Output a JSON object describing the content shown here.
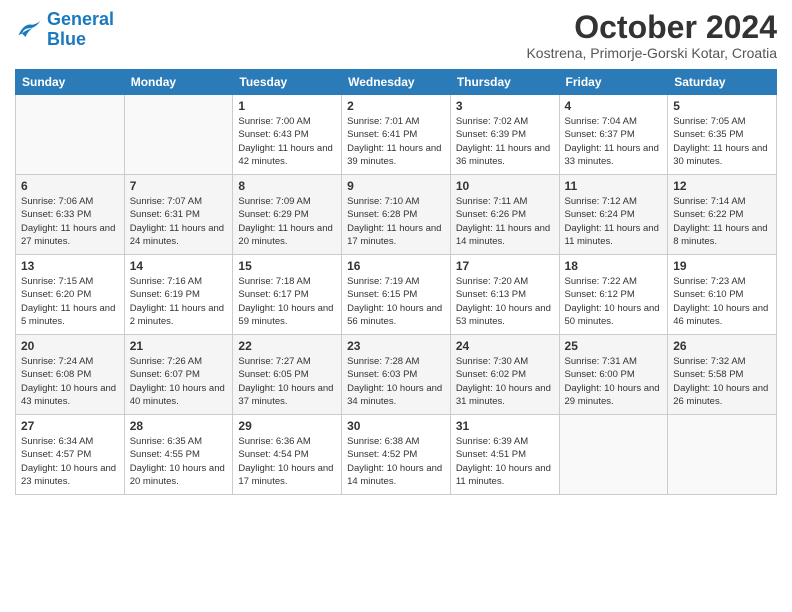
{
  "header": {
    "logo_line1": "General",
    "logo_line2": "Blue",
    "month_title": "October 2024",
    "location": "Kostrena, Primorje-Gorski Kotar, Croatia"
  },
  "weekdays": [
    "Sunday",
    "Monday",
    "Tuesday",
    "Wednesday",
    "Thursday",
    "Friday",
    "Saturday"
  ],
  "weeks": [
    [
      {
        "day": "",
        "sunrise": "",
        "sunset": "",
        "daylight": ""
      },
      {
        "day": "",
        "sunrise": "",
        "sunset": "",
        "daylight": ""
      },
      {
        "day": "1",
        "sunrise": "Sunrise: 7:00 AM",
        "sunset": "Sunset: 6:43 PM",
        "daylight": "Daylight: 11 hours and 42 minutes."
      },
      {
        "day": "2",
        "sunrise": "Sunrise: 7:01 AM",
        "sunset": "Sunset: 6:41 PM",
        "daylight": "Daylight: 11 hours and 39 minutes."
      },
      {
        "day": "3",
        "sunrise": "Sunrise: 7:02 AM",
        "sunset": "Sunset: 6:39 PM",
        "daylight": "Daylight: 11 hours and 36 minutes."
      },
      {
        "day": "4",
        "sunrise": "Sunrise: 7:04 AM",
        "sunset": "Sunset: 6:37 PM",
        "daylight": "Daylight: 11 hours and 33 minutes."
      },
      {
        "day": "5",
        "sunrise": "Sunrise: 7:05 AM",
        "sunset": "Sunset: 6:35 PM",
        "daylight": "Daylight: 11 hours and 30 minutes."
      }
    ],
    [
      {
        "day": "6",
        "sunrise": "Sunrise: 7:06 AM",
        "sunset": "Sunset: 6:33 PM",
        "daylight": "Daylight: 11 hours and 27 minutes."
      },
      {
        "day": "7",
        "sunrise": "Sunrise: 7:07 AM",
        "sunset": "Sunset: 6:31 PM",
        "daylight": "Daylight: 11 hours and 24 minutes."
      },
      {
        "day": "8",
        "sunrise": "Sunrise: 7:09 AM",
        "sunset": "Sunset: 6:29 PM",
        "daylight": "Daylight: 11 hours and 20 minutes."
      },
      {
        "day": "9",
        "sunrise": "Sunrise: 7:10 AM",
        "sunset": "Sunset: 6:28 PM",
        "daylight": "Daylight: 11 hours and 17 minutes."
      },
      {
        "day": "10",
        "sunrise": "Sunrise: 7:11 AM",
        "sunset": "Sunset: 6:26 PM",
        "daylight": "Daylight: 11 hours and 14 minutes."
      },
      {
        "day": "11",
        "sunrise": "Sunrise: 7:12 AM",
        "sunset": "Sunset: 6:24 PM",
        "daylight": "Daylight: 11 hours and 11 minutes."
      },
      {
        "day": "12",
        "sunrise": "Sunrise: 7:14 AM",
        "sunset": "Sunset: 6:22 PM",
        "daylight": "Daylight: 11 hours and 8 minutes."
      }
    ],
    [
      {
        "day": "13",
        "sunrise": "Sunrise: 7:15 AM",
        "sunset": "Sunset: 6:20 PM",
        "daylight": "Daylight: 11 hours and 5 minutes."
      },
      {
        "day": "14",
        "sunrise": "Sunrise: 7:16 AM",
        "sunset": "Sunset: 6:19 PM",
        "daylight": "Daylight: 11 hours and 2 minutes."
      },
      {
        "day": "15",
        "sunrise": "Sunrise: 7:18 AM",
        "sunset": "Sunset: 6:17 PM",
        "daylight": "Daylight: 10 hours and 59 minutes."
      },
      {
        "day": "16",
        "sunrise": "Sunrise: 7:19 AM",
        "sunset": "Sunset: 6:15 PM",
        "daylight": "Daylight: 10 hours and 56 minutes."
      },
      {
        "day": "17",
        "sunrise": "Sunrise: 7:20 AM",
        "sunset": "Sunset: 6:13 PM",
        "daylight": "Daylight: 10 hours and 53 minutes."
      },
      {
        "day": "18",
        "sunrise": "Sunrise: 7:22 AM",
        "sunset": "Sunset: 6:12 PM",
        "daylight": "Daylight: 10 hours and 50 minutes."
      },
      {
        "day": "19",
        "sunrise": "Sunrise: 7:23 AM",
        "sunset": "Sunset: 6:10 PM",
        "daylight": "Daylight: 10 hours and 46 minutes."
      }
    ],
    [
      {
        "day": "20",
        "sunrise": "Sunrise: 7:24 AM",
        "sunset": "Sunset: 6:08 PM",
        "daylight": "Daylight: 10 hours and 43 minutes."
      },
      {
        "day": "21",
        "sunrise": "Sunrise: 7:26 AM",
        "sunset": "Sunset: 6:07 PM",
        "daylight": "Daylight: 10 hours and 40 minutes."
      },
      {
        "day": "22",
        "sunrise": "Sunrise: 7:27 AM",
        "sunset": "Sunset: 6:05 PM",
        "daylight": "Daylight: 10 hours and 37 minutes."
      },
      {
        "day": "23",
        "sunrise": "Sunrise: 7:28 AM",
        "sunset": "Sunset: 6:03 PM",
        "daylight": "Daylight: 10 hours and 34 minutes."
      },
      {
        "day": "24",
        "sunrise": "Sunrise: 7:30 AM",
        "sunset": "Sunset: 6:02 PM",
        "daylight": "Daylight: 10 hours and 31 minutes."
      },
      {
        "day": "25",
        "sunrise": "Sunrise: 7:31 AM",
        "sunset": "Sunset: 6:00 PM",
        "daylight": "Daylight: 10 hours and 29 minutes."
      },
      {
        "day": "26",
        "sunrise": "Sunrise: 7:32 AM",
        "sunset": "Sunset: 5:58 PM",
        "daylight": "Daylight: 10 hours and 26 minutes."
      }
    ],
    [
      {
        "day": "27",
        "sunrise": "Sunrise: 6:34 AM",
        "sunset": "Sunset: 4:57 PM",
        "daylight": "Daylight: 10 hours and 23 minutes."
      },
      {
        "day": "28",
        "sunrise": "Sunrise: 6:35 AM",
        "sunset": "Sunset: 4:55 PM",
        "daylight": "Daylight: 10 hours and 20 minutes."
      },
      {
        "day": "29",
        "sunrise": "Sunrise: 6:36 AM",
        "sunset": "Sunset: 4:54 PM",
        "daylight": "Daylight: 10 hours and 17 minutes."
      },
      {
        "day": "30",
        "sunrise": "Sunrise: 6:38 AM",
        "sunset": "Sunset: 4:52 PM",
        "daylight": "Daylight: 10 hours and 14 minutes."
      },
      {
        "day": "31",
        "sunrise": "Sunrise: 6:39 AM",
        "sunset": "Sunset: 4:51 PM",
        "daylight": "Daylight: 10 hours and 11 minutes."
      },
      {
        "day": "",
        "sunrise": "",
        "sunset": "",
        "daylight": ""
      },
      {
        "day": "",
        "sunrise": "",
        "sunset": "",
        "daylight": ""
      }
    ]
  ]
}
